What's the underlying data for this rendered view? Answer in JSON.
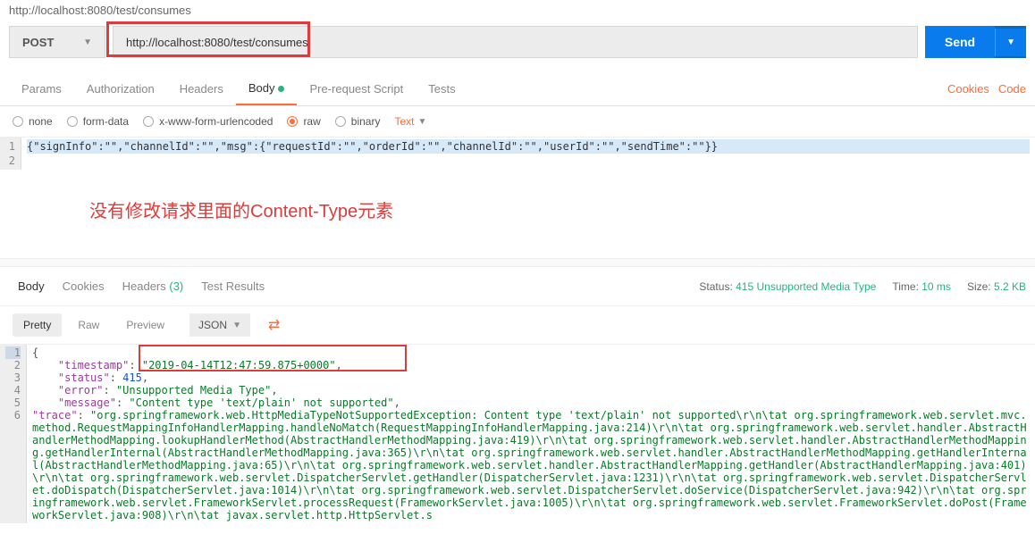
{
  "url_top": "http://localhost:8080/test/consumes",
  "method": "POST",
  "url": "http://localhost:8080/test/consumes",
  "send_label": "Send",
  "tabs": {
    "params": "Params",
    "authorization": "Authorization",
    "headers": "Headers",
    "body": "Body",
    "prerequest": "Pre-request Script",
    "tests": "Tests",
    "cookies_link": "Cookies",
    "code_link": "Code"
  },
  "body_types": {
    "none": "none",
    "formdata": "form-data",
    "xwww": "x-www-form-urlencoded",
    "raw": "raw",
    "binary": "binary",
    "text": "Text"
  },
  "request_body_line": "{\"signInfo\":\"\",\"channelId\":\"\",\"msg\":{\"requestId\":\"\",\"orderId\":\"\",\"channelId\":\"\",\"userId\":\"\",\"sendTime\":\"\"}}",
  "annotation": "没有修改请求里面的Content-Type元素",
  "resp_tabs": {
    "body": "Body",
    "cookies": "Cookies",
    "headers": "Headers",
    "headers_count": "(3)",
    "testresults": "Test Results"
  },
  "status_label": "Status:",
  "status_value": "415 Unsupported Media Type",
  "time_label": "Time:",
  "time_value": "10 ms",
  "size_label": "Size:",
  "size_value": "5.2 KB",
  "view": {
    "pretty": "Pretty",
    "raw": "Raw",
    "preview": "Preview",
    "json": "JSON"
  },
  "resp": {
    "timestamp_k": "\"timestamp\"",
    "timestamp_v": "\"2019-04-14T12:47:59.875+0000\"",
    "status_k": "\"status\"",
    "status_v": "415",
    "error_k": "\"error\"",
    "error_v": "\"Unsupported Media Type\"",
    "message_k": "\"message\"",
    "message_v": "\"Content type 'text/plain' not supported\"",
    "trace_k": "\"trace\"",
    "trace_v": "\"org.springframework.web.HttpMediaTypeNotSupportedException: Content type 'text/plain' not supported\\r\\n\\tat org.springframework.web.servlet.mvc.method.RequestMappingInfoHandlerMapping.handleNoMatch(RequestMappingInfoHandlerMapping.java:214)\\r\\n\\tat org.springframework.web.servlet.handler.AbstractHandlerMethodMapping.lookupHandlerMethod(AbstractHandlerMethodMapping.java:419)\\r\\n\\tat org.springframework.web.servlet.handler.AbstractHandlerMethodMapping.getHandlerInternal(AbstractHandlerMethodMapping.java:365)\\r\\n\\tat org.springframework.web.servlet.handler.AbstractHandlerMethodMapping.getHandlerInternal(AbstractHandlerMethodMapping.java:65)\\r\\n\\tat org.springframework.web.servlet.handler.AbstractHandlerMapping.getHandler(AbstractHandlerMapping.java:401)\\r\\n\\tat org.springframework.web.servlet.DispatcherServlet.getHandler(DispatcherServlet.java:1231)\\r\\n\\tat org.springframework.web.servlet.DispatcherServlet.doDispatch(DispatcherServlet.java:1014)\\r\\n\\tat org.springframework.web.servlet.DispatcherServlet.doService(DispatcherServlet.java:942)\\r\\n\\tat org.springframework.web.servlet.FrameworkServlet.processRequest(FrameworkServlet.java:1005)\\r\\n\\tat org.springframework.web.servlet.FrameworkServlet.doPost(FrameworkServlet.java:908)\\r\\n\\tat javax.servlet.http.HttpServlet.s"
  }
}
